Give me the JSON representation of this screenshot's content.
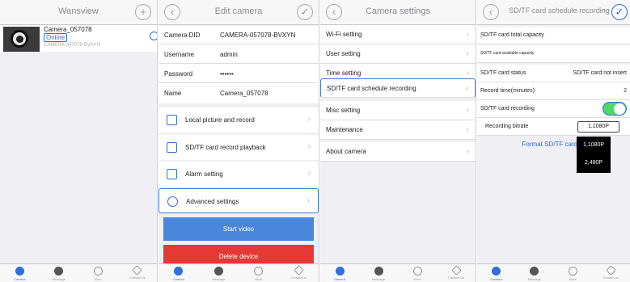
{
  "colors": {
    "accent": "#2f6fd6",
    "start_button": "#4a86d9",
    "delete_button": "#e53935",
    "toggle_on": "#4cd964"
  },
  "tabbar": [
    {
      "label": "Camera",
      "icon": "camera-icon"
    },
    {
      "label": "Message",
      "icon": "message-icon"
    },
    {
      "label": "More",
      "icon": "more-icon"
    },
    {
      "label": "Contact Us",
      "icon": "contact-icon"
    }
  ],
  "panel1": {
    "title": "Wansview",
    "add_icon": "+",
    "camera": {
      "name": "Camera_057078",
      "status": "Online",
      "did": "CAMERA-057078-BVXYN"
    }
  },
  "panel2": {
    "title": "Edit camera",
    "fields": [
      {
        "label": "Camera DID",
        "value": "CAMERA-057078-BVXYN"
      },
      {
        "label": "Username",
        "value": "admin"
      },
      {
        "label": "Password",
        "value": "••••••"
      },
      {
        "label": "Name",
        "value": "Camera_057078"
      }
    ],
    "menu": [
      {
        "label": "Local picture and record",
        "icon": "picture-icon"
      },
      {
        "label": "SD/TF card record playback",
        "icon": "playback-icon"
      },
      {
        "label": "Alarm setting",
        "icon": "alarm-icon"
      },
      {
        "label": "Advanced settings",
        "icon": "gear-icon"
      }
    ],
    "start_video": "Start video",
    "delete_device": "Delete device"
  },
  "panel3": {
    "title": "Camera settings",
    "group1": [
      "Wi-Fi setting",
      "User setting",
      "Time setting",
      "SD/TF card schedule recording"
    ],
    "group2": [
      "Misc setting",
      "Maintenance"
    ],
    "group3": [
      "About camera"
    ]
  },
  "panel4": {
    "title": "SD/TF card schedule recording",
    "rows": [
      {
        "label": "SD/TF card total capacity",
        "value": ""
      },
      {
        "label": "SD/TF card available capacity",
        "value": ""
      },
      {
        "label": "SD/TF card status",
        "value": "SD/TF card not insert"
      },
      {
        "label": "Record time(minutes)",
        "value": "2"
      },
      {
        "label": "SD/TF card recording",
        "value": ""
      },
      {
        "label": "Recording bitrate",
        "value": "1,1080P"
      }
    ],
    "recording_enabled": true,
    "format_label": "Format SD/TF card",
    "bitrate_options": [
      "1,1080P",
      "2,480P"
    ]
  }
}
